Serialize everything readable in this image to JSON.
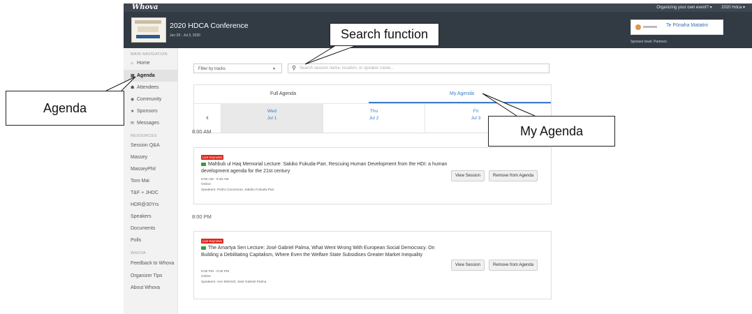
{
  "topbar": {
    "logo": "Whova",
    "organize_link": "Organizing your own event? ▾",
    "user_menu": "2020 Hdca ▾"
  },
  "header": {
    "title": "2020 HDCA Conference",
    "dates": "Jun 29 - Jul 3, 2020",
    "sponsor_name": "Te Pūnaha Matatini",
    "sponsor_level": "Sponsor level: Partners"
  },
  "sidebar": {
    "main_nav_label": "MAIN NAVIGATION",
    "main_items": [
      {
        "label": "Home",
        "icon": "home-icon"
      },
      {
        "label": "Agenda",
        "icon": "calendar-icon"
      },
      {
        "label": "Attendees",
        "icon": "people-icon"
      },
      {
        "label": "Community",
        "icon": "community-icon"
      },
      {
        "label": "Sponsors",
        "icon": "sponsor-icon"
      },
      {
        "label": "Messages",
        "icon": "message-icon"
      }
    ],
    "resources_label": "RESOURCES",
    "resource_items": [
      "Session Q&A",
      "Massey",
      "MasseyPhil",
      "Toro Mai",
      "T&F + JHDC",
      "HDR@30Yrs",
      "Speakers",
      "Documents",
      "Polls"
    ],
    "whova_label": "WHOVA",
    "whova_items": [
      "Feedback to Whova",
      "Organizer Tips",
      "About Whova"
    ]
  },
  "filters": {
    "track_filter": "Filter by tracks",
    "search_placeholder": "Search session name, location, or speaker name..."
  },
  "agenda_tabs": {
    "full": "Full Agenda",
    "mine": "My Agenda"
  },
  "days": [
    {
      "dow": "Wed",
      "date": "Jul 1"
    },
    {
      "dow": "Thu",
      "date": "Jul 2"
    },
    {
      "dow": "Fri",
      "date": "Jul 3"
    }
  ],
  "sessions": [
    {
      "time_heading": "8:00 AM",
      "badge": "Live Keynotes",
      "title": "Mahbub ul Haq Memorial Lecture: Sakiko Fukuda-Parr, Rescuing Human Development from the HDI: a human development agenda for the 21st century",
      "time": "8:00 AM - 9:30 AM",
      "location": "Online",
      "speakers": "Speakers: Pedro Conceicao, Sakiko Fukuda-Parr",
      "view_label": "View Session",
      "remove_label": "Remove from Agenda"
    },
    {
      "time_heading": "8:00 PM",
      "badge": "Live Keynotes",
      "title": "The Amartya Sen Lecture: José Gabriel Palma, What Went Wrong With European Social Democracy. On Building a Debilitating Capitalism, Where Even the Welfare State Subsidises Greater Market Inequality",
      "time": "8:00 PM - 9:30 PM",
      "location": "Online",
      "speakers": "Speakers: Ann Mitchell, José Gabriel Palma",
      "view_label": "View Session",
      "remove_label": "Remove from Agenda"
    }
  ],
  "annotations": {
    "search": "Search function",
    "agenda": "Agenda",
    "my_agenda": "My Agenda"
  }
}
